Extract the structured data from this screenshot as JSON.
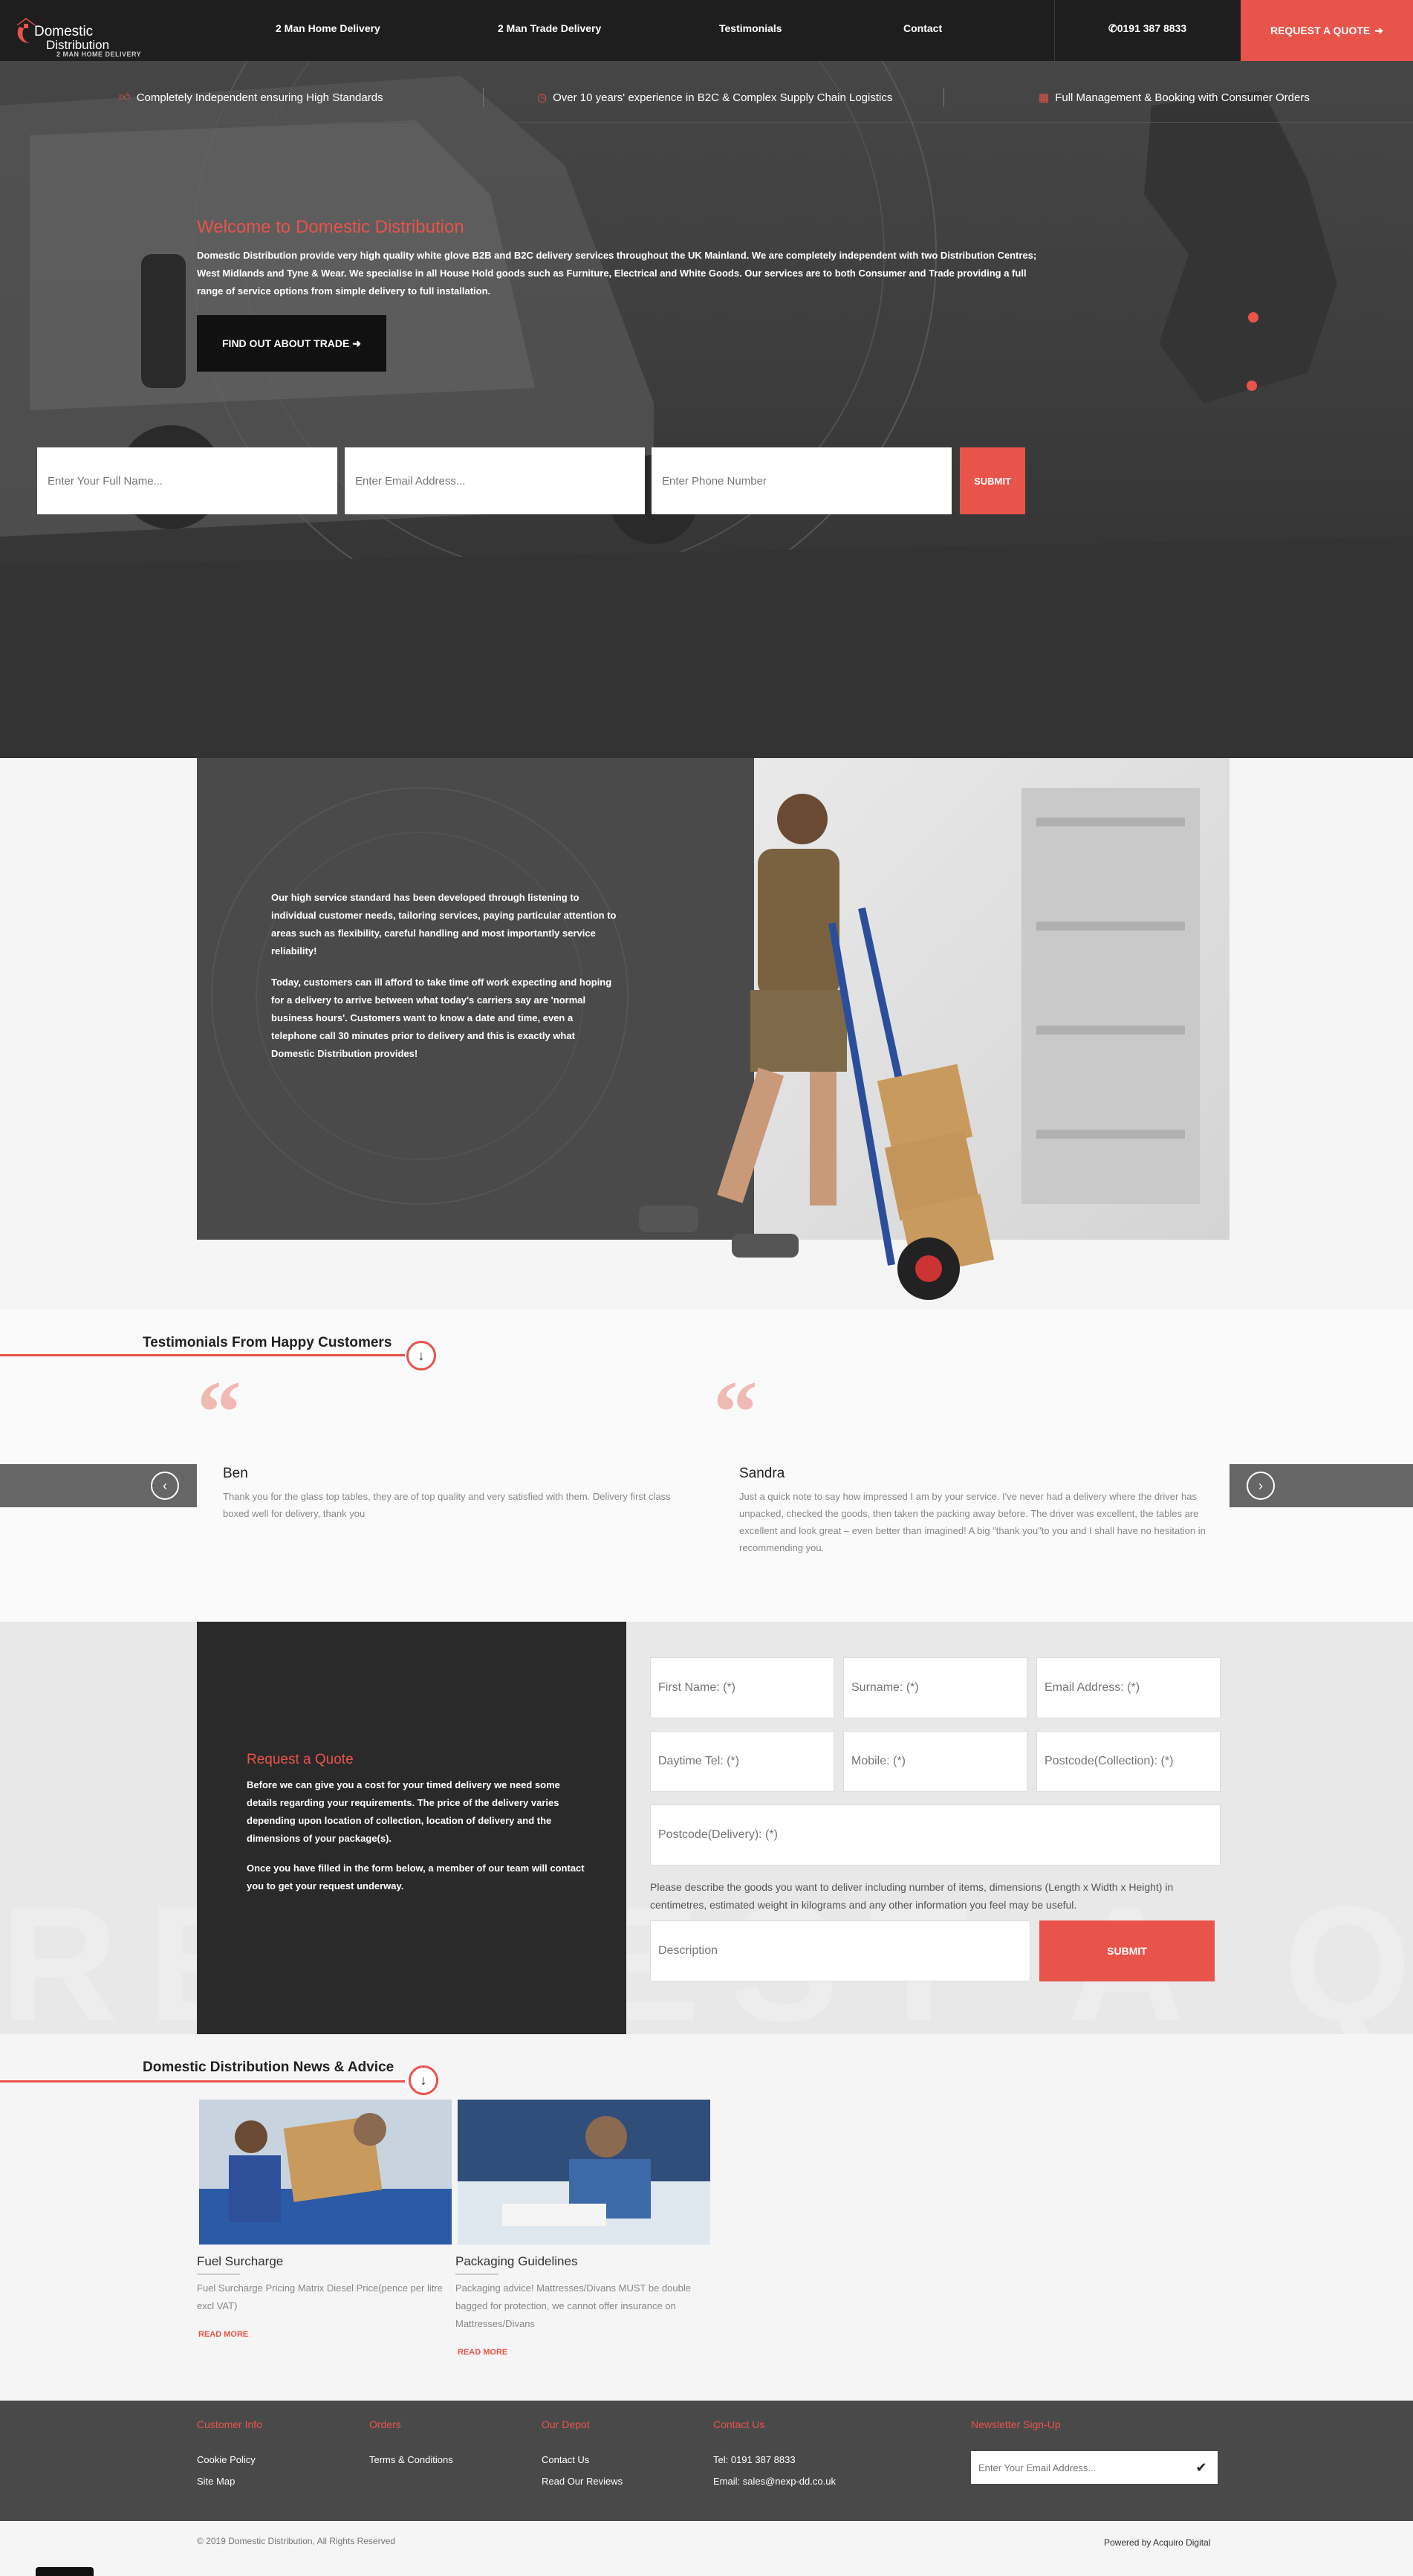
{
  "header": {
    "logo": {
      "line1": "Domestic",
      "line2": "Distribution",
      "tagline": "2 MAN HOME DELIVERY"
    },
    "nav": [
      "2 Man Home Delivery",
      "2 Man Trade Delivery",
      "Testimonials",
      "Contact"
    ],
    "phone": "0191 387 8833",
    "quote_button": "REQUEST A QUOTE"
  },
  "usps": [
    {
      "icon": "thumbs-up-icon",
      "text": "Completely Independent ensuring High Standards"
    },
    {
      "icon": "clock-icon",
      "text": "Over 10 years' experience in B2C & Complex Supply Chain Logistics"
    },
    {
      "icon": "calendar-icon",
      "text": "Full Management & Booking with Consumer Orders"
    }
  ],
  "hero": {
    "title": "Welcome to Domestic Distribution",
    "text": "Domestic Distribution provide very high quality white glove B2B and B2C delivery services throughout the UK Mainland.  We are completely independent with two Distribution Centres; West Midlands and Tyne & Wear.  We specialise in all House Hold goods such as Furniture, Electrical and White Goods.  Our services are to both Consumer and Trade providing a full range of service options from simple delivery to full installation.",
    "trade_button": "FIND OUT ABOUT TRADE",
    "form": {
      "name_placeholder": "Enter Your Full Name...",
      "email_placeholder": "Enter Email Address...",
      "phone_placeholder": "Enter Phone Number",
      "submit": "SUBMIT"
    }
  },
  "about": {
    "p1": "Our high service standard has been developed through listening to individual customer needs, tailoring services, paying particular attention to areas such as flexibility, careful handling and most importantly service reliability!",
    "p2": "Today, customers can ill afford to take time off work expecting and hoping for a delivery to arrive between what today's carriers say are 'normal business hours'. Customers want to know a date and time, even a telephone call 30 minutes prior to delivery and this is exactly what Domestic Distribution provides!"
  },
  "testimonials": {
    "title": "Testimonials From Happy Customers",
    "items": [
      {
        "name": "Ben",
        "text": "Thank you for the glass top tables, they are of top quality and very satisfied with them. Delivery first class boxed well for delivery, thank you"
      },
      {
        "name": "Sandra",
        "text": "Just a quick note to say how impressed I am by your service. I've never had a delivery where the driver has unpacked, checked the goods, then taken the packing away before. The driver was excellent, the tables are excellent and look great – even better than imagined! A big \"thank you\"to you and I shall have no hesitation in recommending you."
      }
    ]
  },
  "quote_form": {
    "bg_word": "REQUEST A QUOTE",
    "title": "Request a Quote",
    "p1": "Before we can give you a cost for your timed delivery we need some details regarding your requirements. The price of the delivery varies depending upon location of collection, location of delivery and the dimensions of your package(s).",
    "p2": "Once you have filled in the form below, a member of our team will contact you to get your request underway.",
    "fields": {
      "first_name": "First Name: (*)",
      "surname": "Surname: (*)",
      "email": "Email Address: (*)",
      "daytime_tel": "Daytime Tel: (*)",
      "mobile": "Mobile: (*)",
      "postcode_collection": "Postcode(Collection): (*)",
      "postcode_delivery": "Postcode(Delivery): (*)",
      "description": "Description"
    },
    "note": "Please describe the goods you want to deliver including number of items, dimensions (Length x Width x Height) in centimetres, estimated weight in kilograms and any other information you feel may be useful.",
    "submit": "SUBMIT"
  },
  "news": {
    "title": "Domestic Distribution News & Advice",
    "items": [
      {
        "title": "Fuel Surcharge",
        "text": "Fuel Surcharge Pricing Matrix Diesel Price(pence per litre excl VAT)",
        "more": "READ MORE"
      },
      {
        "title": "Packaging Guidelines",
        "text": "Packaging advice! Mattresses/Divans MUST be double bagged for protection, we cannot offer insurance on Mattresses/Divans",
        "more": "READ MORE"
      }
    ]
  },
  "footer": {
    "customer_info": {
      "title": "Customer Info",
      "links": [
        "Cookie Policy",
        "Site Map"
      ]
    },
    "orders": {
      "title": "Orders",
      "links": [
        "Terms & Conditions"
      ]
    },
    "depot": {
      "title": "Our Depot",
      "links": [
        "Contact Us",
        "Read Our Reviews"
      ]
    },
    "contact": {
      "title": "Contact Us",
      "tel": "Tel: 0191 387 8833",
      "email": "Email: sales@nexp-dd.co.uk"
    },
    "newsletter": {
      "title": "Newsletter Sign-Up",
      "placeholder": "Enter Your Email Address..."
    },
    "copyright": "© 2019 Domestic Distribution, All Rights Reserved",
    "powered": "Powered by Acquiro Digital"
  },
  "colors": {
    "accent": "#e8534a",
    "dark": "#1e1e1e"
  }
}
